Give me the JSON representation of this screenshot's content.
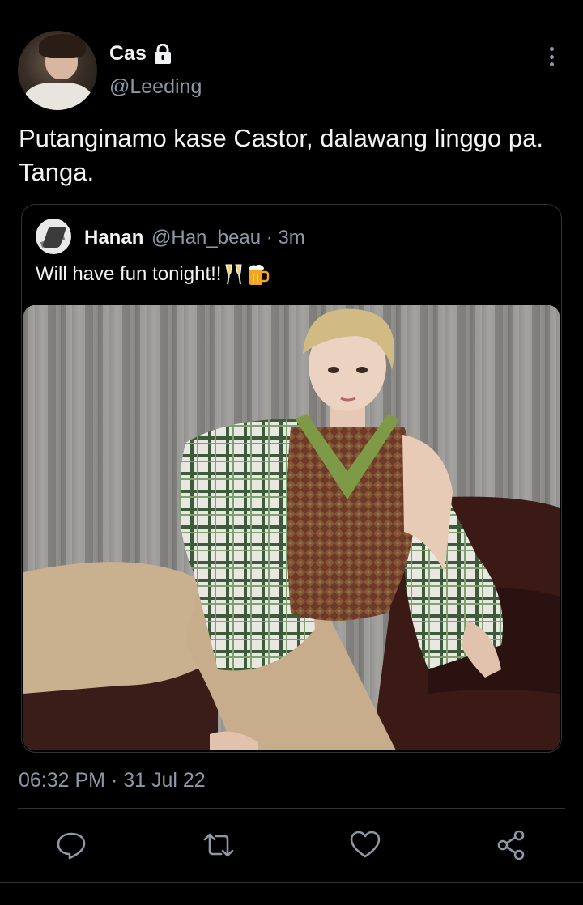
{
  "tweet": {
    "author_name": "Cas",
    "author_handle": "@Leeding",
    "protected_icon": "lock-icon",
    "text": "Putanginamo kase Castor, dalawang linggo pa. Tanga.",
    "timestamp": "06:32 PM · 31 Jul 22"
  },
  "quoted_tweet": {
    "author_name": "Hanan",
    "author_handle": "@Han_beau · 3m",
    "text": "Will have fun tonight!!",
    "emojis": [
      "clinking-glasses-icon",
      "beer-mug-icon"
    ],
    "media": "photo"
  },
  "actions": [
    {
      "name": "reply",
      "icon": "reply-icon"
    },
    {
      "name": "retweet",
      "icon": "retweet-icon"
    },
    {
      "name": "like",
      "icon": "heart-icon"
    },
    {
      "name": "share",
      "icon": "share-icon"
    }
  ],
  "colors": {
    "background": "#000000",
    "text": "#f2f3f4",
    "muted": "#8b98a5",
    "border": "#2f3336"
  }
}
